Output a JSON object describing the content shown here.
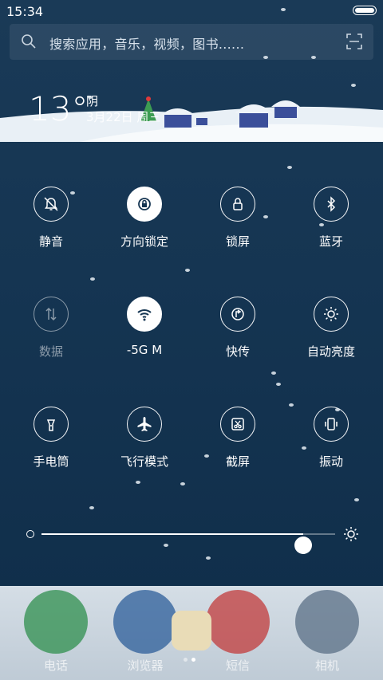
{
  "status": {
    "time": "15:34"
  },
  "search": {
    "placeholder": "搜索应用，音乐，视频，图书......"
  },
  "weather": {
    "temperature": "13°",
    "condition": "阴",
    "date": "3月22日 周三"
  },
  "toggles": [
    {
      "label": "静音",
      "icon": "mute-bell-icon",
      "state": "off"
    },
    {
      "label": "方向锁定",
      "icon": "rotation-lock-icon",
      "state": "on"
    },
    {
      "label": "锁屏",
      "icon": "lock-icon",
      "state": "off"
    },
    {
      "label": "蓝牙",
      "icon": "bluetooth-icon",
      "state": "off"
    },
    {
      "label": "数据",
      "icon": "mobile-data-icon",
      "state": "disabled"
    },
    {
      "label": "-5G        M",
      "icon": "wifi-icon",
      "state": "on"
    },
    {
      "label": "快传",
      "icon": "quick-transfer-icon",
      "state": "off"
    },
    {
      "label": "自动亮度",
      "icon": "auto-brightness-icon",
      "state": "off"
    },
    {
      "label": "手电筒",
      "icon": "flashlight-icon",
      "state": "off"
    },
    {
      "label": "飞行模式",
      "icon": "airplane-icon",
      "state": "off"
    },
    {
      "label": "截屏",
      "icon": "screenshot-icon",
      "state": "off"
    },
    {
      "label": "振动",
      "icon": "vibrate-icon",
      "state": "off"
    }
  ],
  "brightness": {
    "level": 0.89
  },
  "dock": {
    "apps": [
      {
        "label": "电话",
        "icon": "phone-wreath-icon"
      },
      {
        "label": "浏览器",
        "icon": "browser-globe-icon"
      },
      {
        "label": "短信",
        "icon": "messages-santa-hat-icon"
      },
      {
        "label": "相机",
        "icon": "camera-icon"
      }
    ],
    "page_count": 2,
    "active_page": 2
  },
  "colors": {
    "background": "#153552",
    "accent": "#ffffff",
    "dock": "#d6dfe7"
  }
}
